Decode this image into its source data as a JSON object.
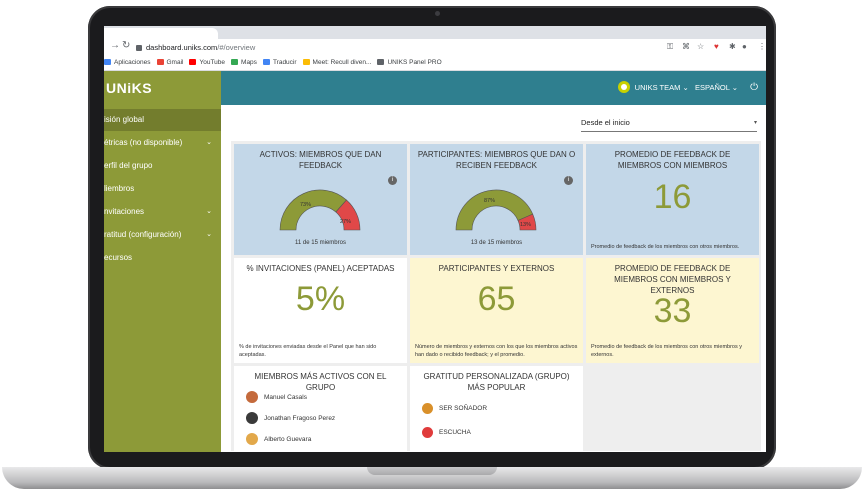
{
  "browser": {
    "url_host": "dashboard.uniks.com",
    "url_path": "/#/overview",
    "bookmarks": [
      "Aplicaciones",
      "Gmail",
      "YouTube",
      "Maps",
      "Traducir",
      "Meet: Recull diven...",
      "UNIKS Panel PRO"
    ],
    "bookmark_colors": [
      "#4285f4",
      "#ea4335",
      "#ff0000",
      "#34a853",
      "#4285f4",
      "#fbbc05",
      "#5f6368"
    ]
  },
  "app": {
    "logo_text": "UNiKS",
    "accent_color": "#8d9a38",
    "header_color": "#2f7f8f"
  },
  "sidebar": {
    "items": [
      {
        "label": "isión global",
        "active": true
      },
      {
        "label": "étricas (no disponible)",
        "chevron": "⌄"
      },
      {
        "label": "erfil del grupo"
      },
      {
        "label": "liembros"
      },
      {
        "label": "nvitaciones",
        "chevron": "⌄"
      },
      {
        "label": "ratitud (configuración)",
        "chevron": "⌄"
      },
      {
        "label": "ecursos"
      }
    ]
  },
  "header": {
    "team_label": "UNIKS TEAM ⌄",
    "language_label": "ESPAÑOL ⌄",
    "power_icon": "⏻"
  },
  "filter": {
    "selected": "Desde el inicio",
    "arrow": "▾"
  },
  "cards": {
    "active": {
      "title": "ACTIVOS: MIEMBROS QUE DAN FEEDBACK",
      "green_label": "73%",
      "red_label": "27%",
      "green_fraction": 0.73,
      "count": "11 de 15 miembros"
    },
    "participants": {
      "title": "PARTICIPANTES: MIEMBROS QUE DAN O RECIBEN FEEDBACK",
      "green_label": "87%",
      "red_label": "13%",
      "green_fraction": 0.87,
      "count": "13 de 15 miembros"
    },
    "avg_members": {
      "title": "PROMEDIO DE FEEDBACK DE MIEMBROS CON MIEMBROS",
      "value": "16",
      "note": "Promedio de feedback de los miembros con otros miembros."
    },
    "invitations": {
      "title": "% INVITACIONES (PANEL) ACEPTADAS",
      "value": "5%",
      "note": "% de invitaciones enviadas desde el Panel que han sido aceptadas."
    },
    "externals": {
      "title": "PARTICIPANTES Y EXTERNOS",
      "value": "65",
      "note": "Número de miembros y externos con los que los miembros activos han dado o recibido feedback; y el promedio."
    },
    "avg_externals": {
      "title": "PROMEDIO DE FEEDBACK DE MIEMBROS CON MIEMBROS Y EXTERNOS",
      "value": "33",
      "note": "Promedio de feedback de los miembros con otros miembros y externos."
    },
    "top_members": {
      "title": "MIEMBROS MÁS ACTIVOS CON EL GRUPO",
      "members": [
        {
          "name": "Manuel Casals",
          "color": "#c46a3c"
        },
        {
          "name": "Jonathan Fragoso Perez",
          "color": "#3a3a3a"
        },
        {
          "name": "Alberto Guevara",
          "color": "#e2a84a"
        }
      ]
    },
    "gratitude": {
      "title": "GRATITUD PERSONALIZADA (GRUPO) MÁS POPULAR",
      "items": [
        {
          "name": "SER SOÑADOR",
          "color": "#d9902a"
        },
        {
          "name": "ESCUCHA",
          "color": "#e03b3b"
        }
      ]
    }
  },
  "colors": {
    "gauge_green": "#8d9a38",
    "gauge_red": "#e04848",
    "big_number": "#8d9a38"
  }
}
